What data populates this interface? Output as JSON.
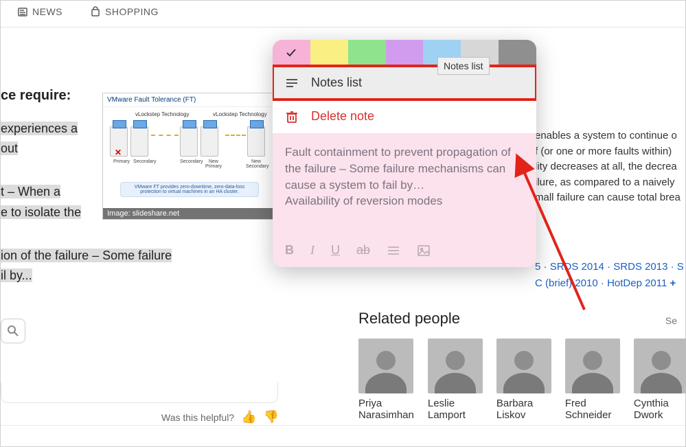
{
  "topnav": {
    "news": "NEWS",
    "shopping": "SHOPPING"
  },
  "left_fragments": {
    "heading_suffix": "ce require:",
    "l1a": "experiences a",
    "l1b": "out",
    "l2a": "t – When a",
    "l2b": "e to isolate the",
    "l3a": "ion of the failure – Some failure",
    "l3b": "il by..."
  },
  "slide": {
    "title": "VMware Fault Tolerance (FT)",
    "tech_label": "vLockstep Technology",
    "caption": "VMware FT provides zero-downtime, zero-data-loss protection to virtual machines in an HA cluster.",
    "labels": {
      "primary": "Primary",
      "secondary": "Secondary",
      "new_primary": "New Primary",
      "new_secondary": "New Secondary"
    },
    "credit": "Image: slideshare.net"
  },
  "note": {
    "tooltip": "Notes list",
    "menu_noteslist": "Notes list",
    "menu_delete": "Delete note",
    "body_line1": "Fault containment to prevent propagation of the failure – Some failure mechanisms can cause a system to fail by…",
    "body_line2": "Availability of reversion modes",
    "fmt": {
      "bold": "B",
      "italic": "I",
      "underline": "U",
      "strike": "ab"
    }
  },
  "panel": {
    "text_l1": "enables a system to continue o",
    "text_l2": "f (or one or more faults within)",
    "text_l3": "lity decreases at all, the decrea",
    "text_l4": "ilure, as compared to a naively",
    "text_l5": "mall failure can cause total brea",
    "links_l1_a": "5 · ",
    "links_l1_b": "SRDS 2014",
    "links_l1_c": " · ",
    "links_l1_d": "SRDS 2013",
    "links_l1_e": " · S",
    "links_l2_a": "C (brief) 2010",
    "links_l2_b": " · ",
    "links_l2_c": "HotDep 2011",
    "links_plus": " +"
  },
  "related": {
    "title": "Related people",
    "see_all": "Se",
    "people": [
      {
        "first": "Priya",
        "last": "Narasimhan"
      },
      {
        "first": "Leslie",
        "last": "Lamport"
      },
      {
        "first": "Barbara",
        "last": "Liskov"
      },
      {
        "first": "Fred",
        "last": "Schneider"
      },
      {
        "first": "Cynthia",
        "last": "Dwork"
      }
    ]
  },
  "feedback": {
    "label": "Was this helpful?"
  }
}
